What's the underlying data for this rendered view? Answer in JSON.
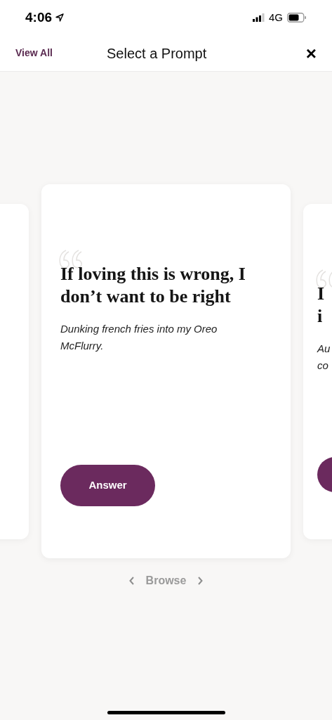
{
  "status_bar": {
    "time": "4:06",
    "network": "4G"
  },
  "header": {
    "left_link": "View All",
    "title": "Select a Prompt",
    "close": "×"
  },
  "cards": [
    {
      "kind": "previous"
    },
    {
      "kind": "current",
      "title": "If loving this is wrong, I\ndon’t want to be right",
      "subtitle": "Dunking french fries into my Oreo McFlurry.",
      "button": "Answer"
    },
    {
      "kind": "next",
      "title": "I\ni",
      "subtitle": "Au\nco"
    }
  ],
  "browse": {
    "label": "Browse"
  }
}
